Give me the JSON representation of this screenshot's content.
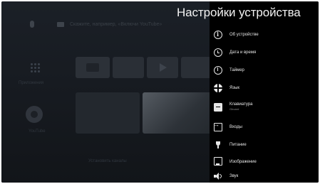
{
  "background": {
    "search_hint": "Скажите, например, «Включи YouTube»",
    "apps_label": "Приложения",
    "youtube_label": "YouTube",
    "install_label": "Установить каналы"
  },
  "panel": {
    "title": "Настройки устройства",
    "items": [
      {
        "label": "Об устройстве",
        "icon": "info-icon"
      },
      {
        "label": "Дата и время",
        "icon": "clock-icon"
      },
      {
        "label": "Таймер",
        "icon": "timer-icon"
      },
      {
        "label": "Язык",
        "icon": "globe-icon"
      },
      {
        "label": "Клавиатура",
        "sublabel": "Gboard",
        "icon": "keyboard-icon"
      },
      {
        "label": "Входы",
        "icon": "input-icon"
      },
      {
        "label": "Питание",
        "icon": "power-icon"
      },
      {
        "label": "Изображение",
        "icon": "display-icon"
      },
      {
        "label": "Звук",
        "icon": "sound-icon"
      }
    ]
  },
  "colors": {
    "panel_background": "#000000",
    "text": "#e8e8e8",
    "home_background": "#1b2027"
  }
}
